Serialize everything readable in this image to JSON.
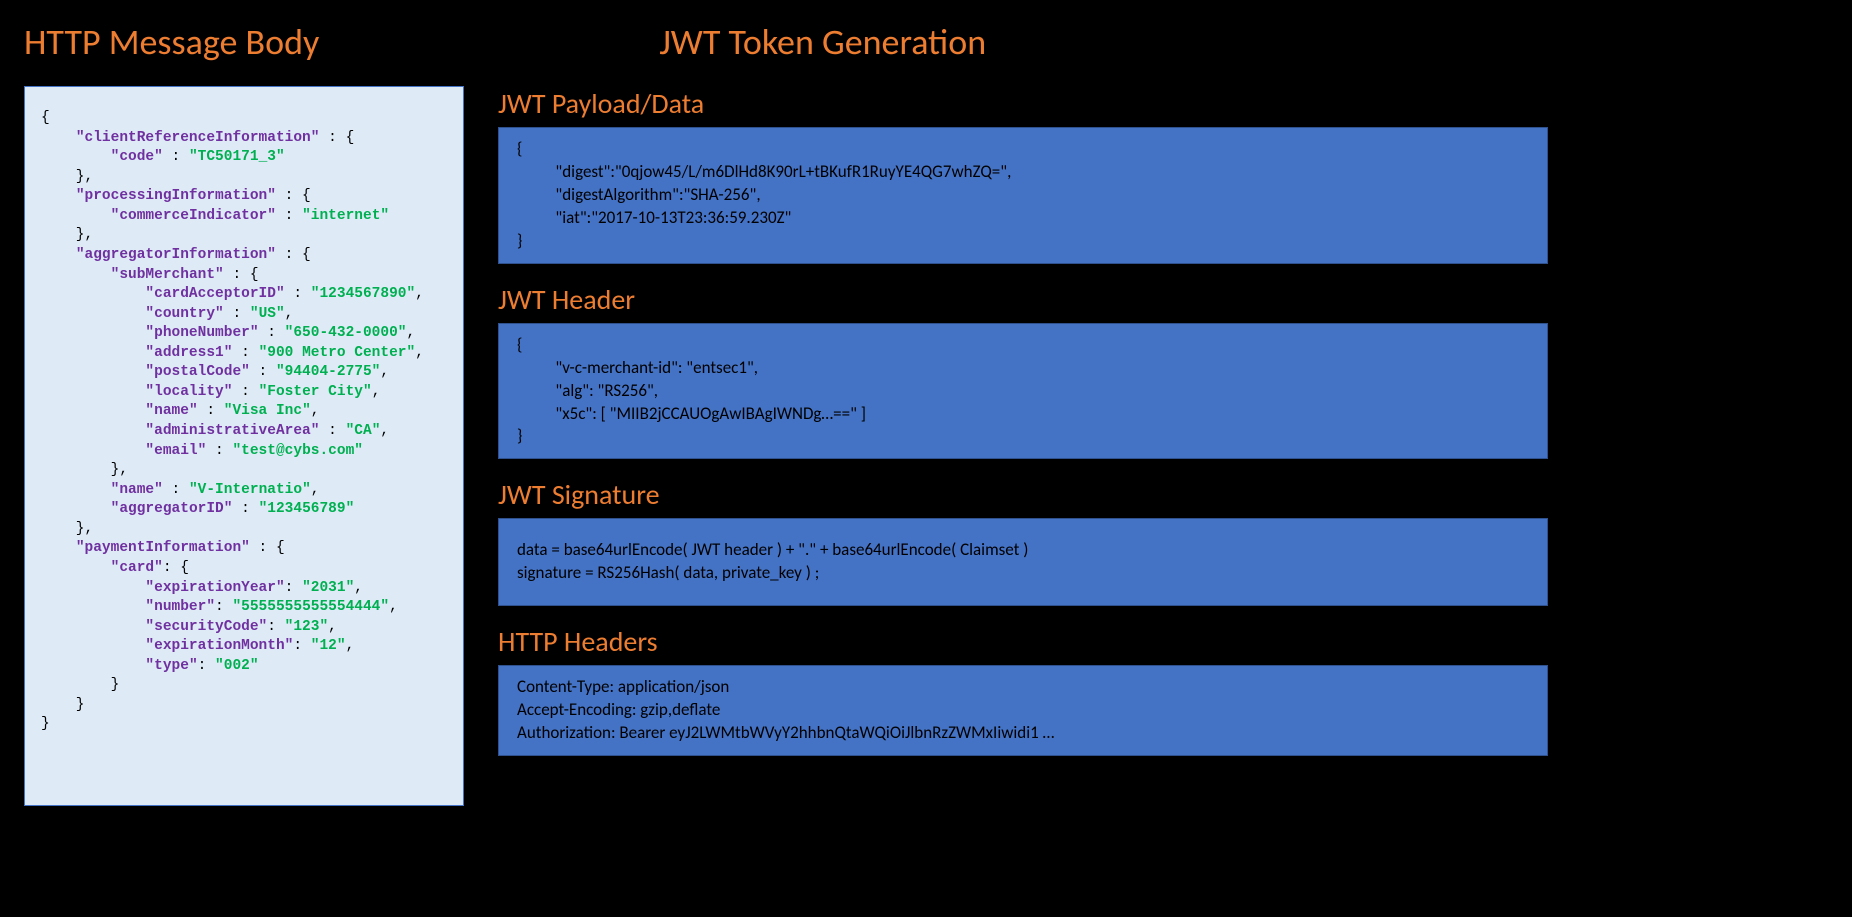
{
  "titles": {
    "left": "HTTP Message Body",
    "right": "JWT Token Generation"
  },
  "sections": {
    "payload": "JWT Payload/Data",
    "header": "JWT Header",
    "signature": "JWT Signature",
    "http": "HTTP Headers"
  },
  "json": {
    "cri": {
      "k": "clientReferenceInformation",
      "code_k": "code",
      "code_v": "TC50171_3"
    },
    "pi": {
      "k": "processingInformation",
      "ci_k": "commerceIndicator",
      "ci_v": "internet"
    },
    "agg": {
      "k": "aggregatorInformation",
      "sub_k": "subMerchant",
      "cardAcceptorID_k": "cardAcceptorID",
      "cardAcceptorID_v": "1234567890",
      "country_k": "country",
      "country_v": "US",
      "phoneNumber_k": "phoneNumber",
      "phoneNumber_v": "650-432-0000",
      "address1_k": "address1",
      "address1_v": "900 Metro Center",
      "postalCode_k": "postalCode",
      "postalCode_v": "94404-2775",
      "locality_k": "locality",
      "locality_v": "Foster City",
      "name_k": "name",
      "name_v": "Visa Inc",
      "administrativeArea_k": "administrativeArea",
      "administrativeArea_v": "CA",
      "email_k": "email",
      "email_v": "test@cybs.com",
      "aggName_k": "name",
      "aggName_v": "V-Internatio",
      "aggID_k": "aggregatorID",
      "aggID_v": "123456789"
    },
    "pay": {
      "k": "paymentInformation",
      "card_k": "card",
      "expYear_k": "expirationYear",
      "expYear_v": "2031",
      "number_k": "number",
      "number_v": "5555555555554444",
      "secCode_k": "securityCode",
      "secCode_v": "123",
      "expMonth_k": "expirationMonth",
      "expMonth_v": "12",
      "type_k": "type",
      "type_v": "002"
    }
  },
  "payload_box": "{\n          \"digest\":\"0qjow45/L/m6DlHd8K90rL+tBKufR1RuyYE4QG7whZQ=\",\n          \"digestAlgorithm\":\"SHA-256\",\n          \"iat\":\"2017-10-13T23:36:59.230Z\"\n}",
  "header_box": "{\n          \"v-c-merchant-id\": \"entsec1\",\n          \"alg\": \"RS256\",\n          \"x5c\": [ \"MIIB2jCCAUOgAwIBAgIWNDg…==\" ]\n}",
  "signature_box": {
    "l1": "data = base64urlEncode( JWT header ) + \".\" + base64urlEncode( Claimset )",
    "l2": "signature = RS256Hash( data, private_key ) ;"
  },
  "http_box": "Content-Type: application/json\nAccept-Encoding: gzip,deflate\nAuthorization: Bearer eyJ2LWMtbWVyY2hhbnQtaWQiOiJlbnRzZWMxIiwidi1 …"
}
